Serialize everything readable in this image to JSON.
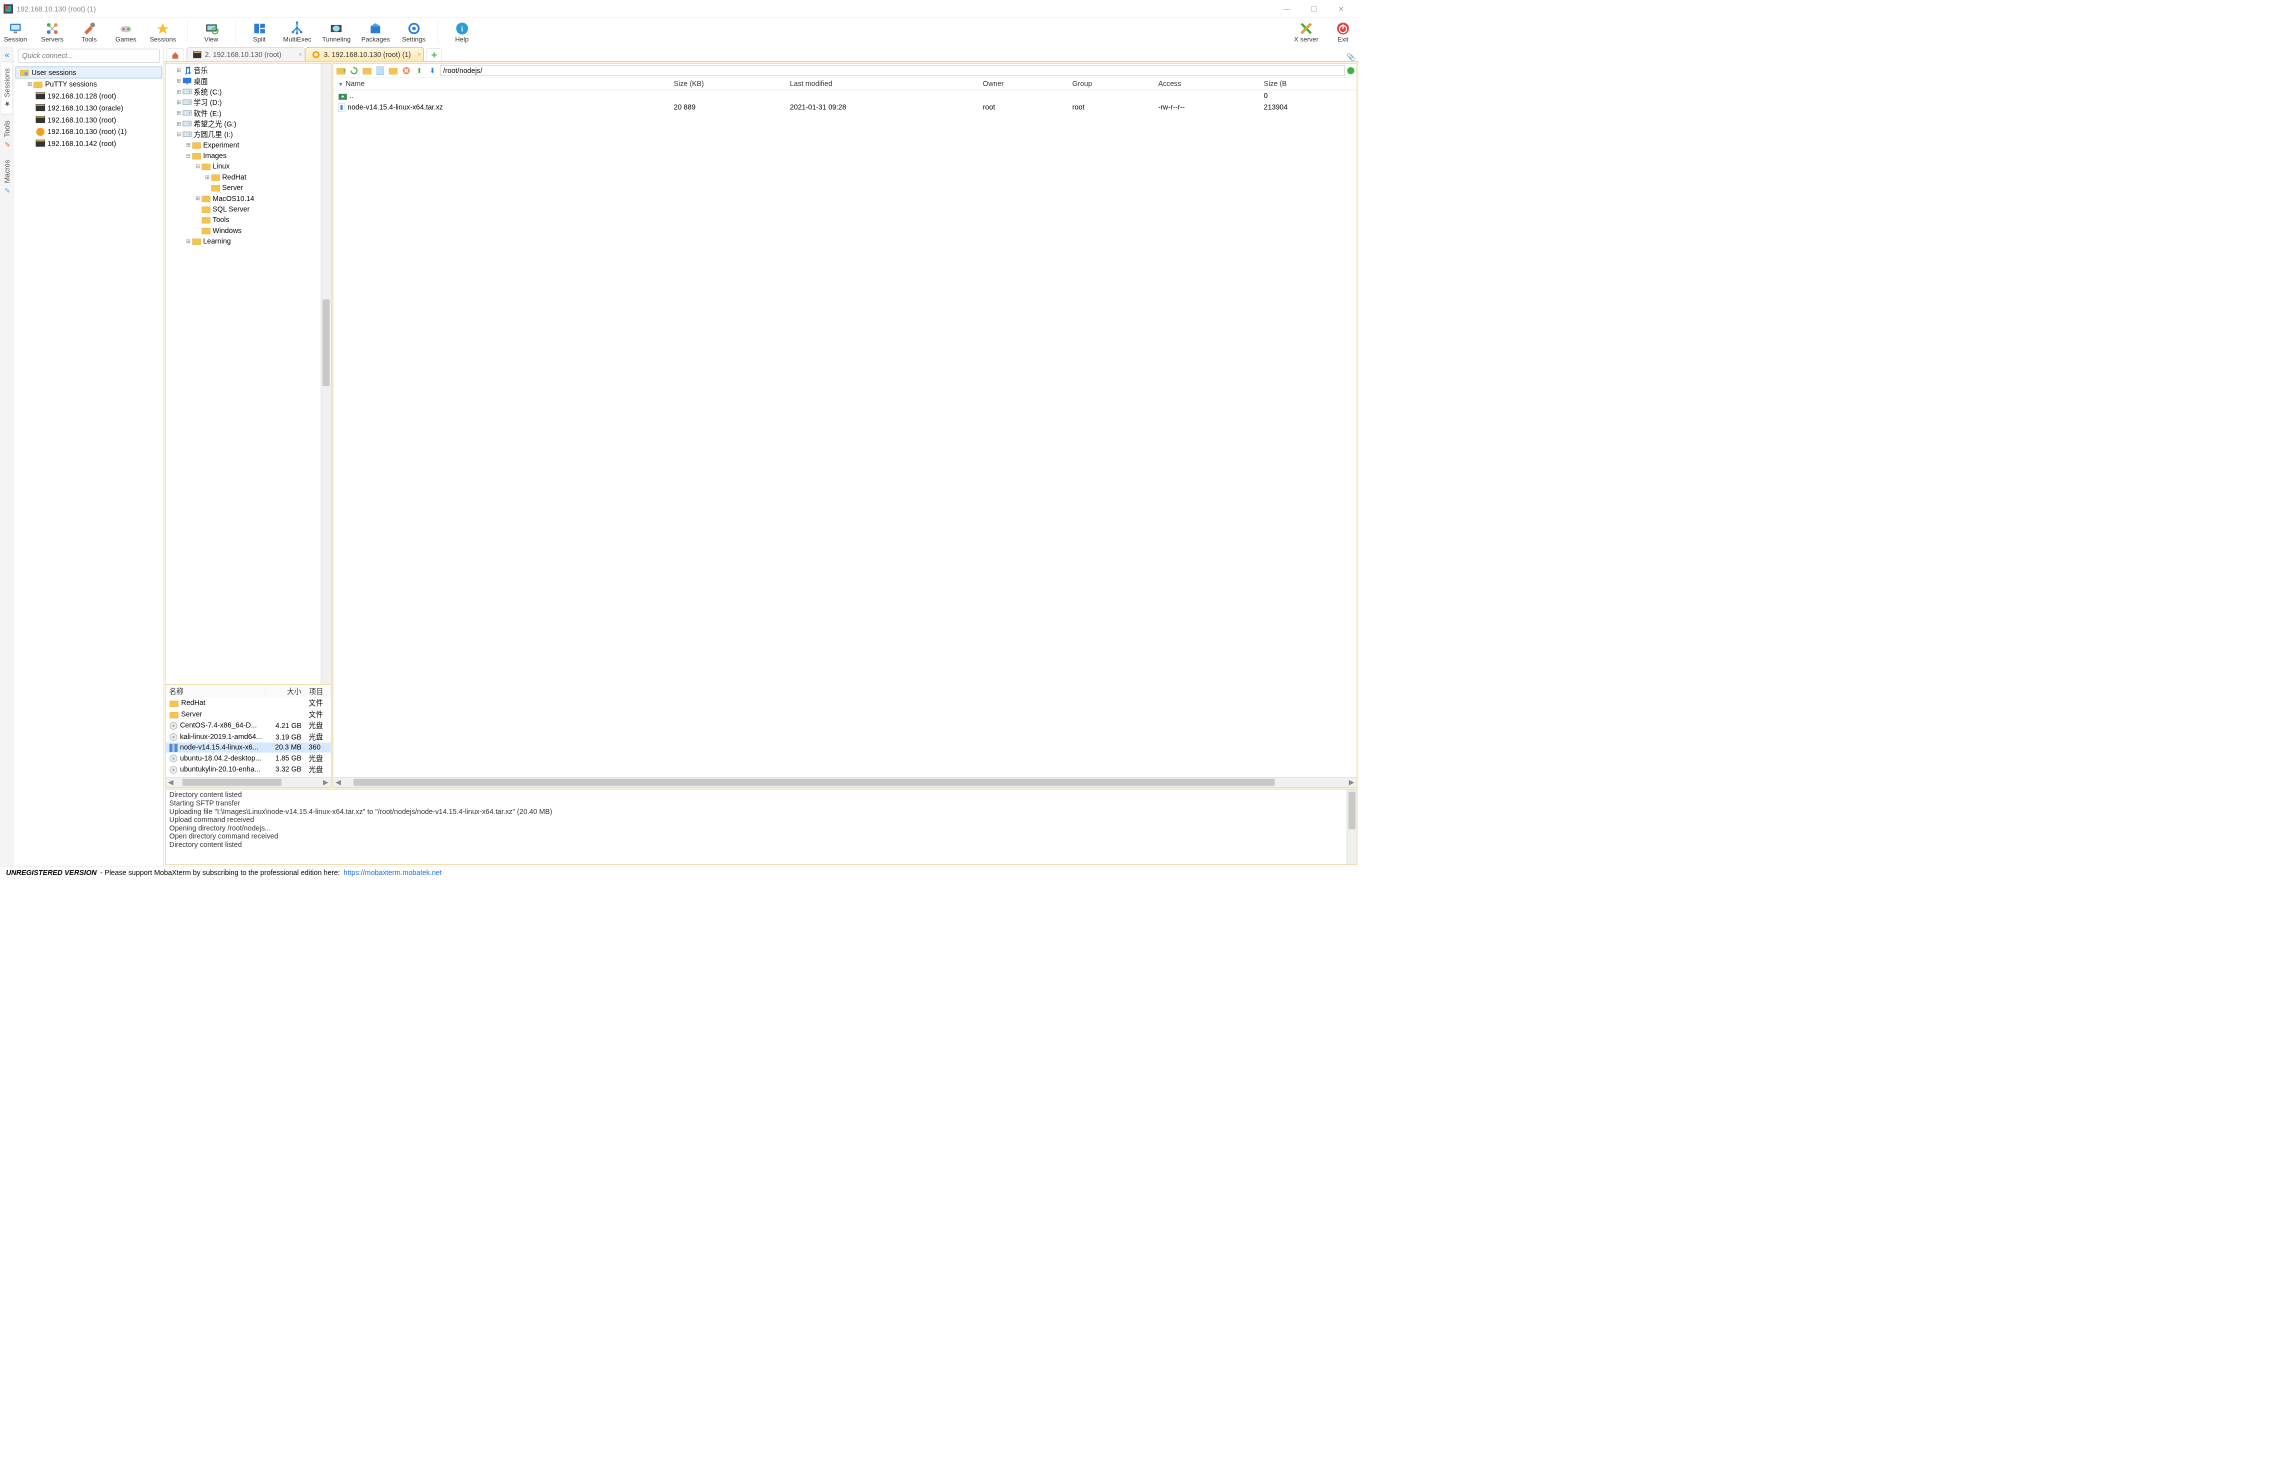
{
  "window": {
    "title": "192.168.10.130 (root) (1)",
    "minimize": "—",
    "maximize": "☐",
    "close": "✕"
  },
  "toolbar": [
    {
      "id": "session",
      "label": "Session"
    },
    {
      "id": "servers",
      "label": "Servers"
    },
    {
      "id": "tools",
      "label": "Tools"
    },
    {
      "id": "games",
      "label": "Games"
    },
    {
      "id": "sessions",
      "label": "Sessions"
    },
    {
      "id": "view",
      "label": "View"
    },
    {
      "id": "split",
      "label": "Split"
    },
    {
      "id": "multiexec",
      "label": "MultiExec"
    },
    {
      "id": "tunneling",
      "label": "Tunneling"
    },
    {
      "id": "packages",
      "label": "Packages"
    },
    {
      "id": "settings",
      "label": "Settings"
    },
    {
      "id": "help",
      "label": "Help"
    }
  ],
  "toolbar_right": [
    {
      "id": "xserver",
      "label": "X server"
    },
    {
      "id": "exit",
      "label": "Exit"
    }
  ],
  "quick_connect_placeholder": "Quick connect...",
  "vtabs": [
    {
      "id": "sessions",
      "label": "Sessions",
      "active": true
    },
    {
      "id": "tools",
      "label": "Tools",
      "active": false
    },
    {
      "id": "macros",
      "label": "Macros",
      "active": false
    }
  ],
  "session_tree": {
    "root": "User sessions",
    "putty_folder": "PuTTY sessions",
    "items": [
      {
        "label": "192.168.10.128 (root)",
        "active": false
      },
      {
        "label": "192.168.10.130 (oracle)",
        "active": false
      },
      {
        "label": "192.168.10.130 (root)",
        "active": false
      },
      {
        "label": "192.168.10.130 (root) (1)",
        "active": true
      },
      {
        "label": "192.168.10.142 (root)",
        "active": false
      }
    ]
  },
  "tabs": [
    {
      "id": "t2",
      "label": "2. 192.168.10.130 (root)",
      "active": false
    },
    {
      "id": "t3",
      "label": "3. 192.168.10.130 (root) (1)",
      "active": true
    }
  ],
  "local_tree": [
    {
      "indent": 0,
      "exp": "⊞",
      "icon": "music",
      "label": "音乐"
    },
    {
      "indent": 0,
      "exp": "⊞",
      "icon": "desktop",
      "label": "桌面"
    },
    {
      "indent": 0,
      "exp": "⊞",
      "icon": "drive",
      "label": "系统 (C:)"
    },
    {
      "indent": 0,
      "exp": "⊞",
      "icon": "drive",
      "label": "学习 (D:)"
    },
    {
      "indent": 0,
      "exp": "⊞",
      "icon": "drive",
      "label": "软件 (E:)"
    },
    {
      "indent": 0,
      "exp": "⊞",
      "icon": "drive",
      "label": "希望之光 (G:)"
    },
    {
      "indent": 0,
      "exp": "⊟",
      "icon": "drive",
      "label": "方圆几里 (I:)"
    },
    {
      "indent": 1,
      "exp": "⊞",
      "icon": "folder",
      "label": "Experiment"
    },
    {
      "indent": 1,
      "exp": "⊟",
      "icon": "folder",
      "label": "Images"
    },
    {
      "indent": 2,
      "exp": "⊟",
      "icon": "folder",
      "label": "Linux"
    },
    {
      "indent": 3,
      "exp": "⊞",
      "icon": "folder",
      "label": "RedHat"
    },
    {
      "indent": 3,
      "exp": "",
      "icon": "folder",
      "label": "Server"
    },
    {
      "indent": 2,
      "exp": "⊞",
      "icon": "folder",
      "label": "MacOS10.14"
    },
    {
      "indent": 2,
      "exp": "",
      "icon": "folder",
      "label": "SQL Server"
    },
    {
      "indent": 2,
      "exp": "",
      "icon": "folder",
      "label": "Tools"
    },
    {
      "indent": 2,
      "exp": "",
      "icon": "folder",
      "label": "Windows"
    },
    {
      "indent": 1,
      "exp": "⊞",
      "icon": "folder",
      "label": "Learning"
    }
  ],
  "local_list": {
    "headers": [
      "名称",
      "大小",
      "项目"
    ],
    "rows": [
      {
        "icon": "folder",
        "name": "RedHat",
        "size": "",
        "type": "文件",
        "selected": false
      },
      {
        "icon": "folder",
        "name": "Server",
        "size": "",
        "type": "文件",
        "selected": false
      },
      {
        "icon": "iso",
        "name": "CentOS-7.4-x86_64-D...",
        "size": "4.21 GB",
        "type": "光盘",
        "selected": false
      },
      {
        "icon": "iso",
        "name": "kali-linux-2019.1-amd64...",
        "size": "3.19 GB",
        "type": "光盘",
        "selected": false
      },
      {
        "icon": "archive",
        "name": "node-v14.15.4-linux-x6...",
        "size": "20.3 MB",
        "type": "360",
        "selected": true
      },
      {
        "icon": "iso",
        "name": "ubuntu-18.04.2-desktop...",
        "size": "1.85 GB",
        "type": "光盘",
        "selected": false
      },
      {
        "icon": "iso",
        "name": "ubuntukylin-20.10-enha...",
        "size": "3.32 GB",
        "type": "光盘",
        "selected": false
      }
    ]
  },
  "sftp": {
    "path": "/root/nodejs/",
    "headers": [
      "Name",
      "Size (KB)",
      "Last modified",
      "Owner",
      "Group",
      "Access",
      "Size (B"
    ],
    "parent_row": "..",
    "rows": [
      {
        "name": "node-v14.15.4-linux-x64.tar.xz",
        "size": "20 889",
        "modified": "2021-01-31 09:28",
        "owner": "root",
        "group": "root",
        "access": "-rw-r--r--",
        "sizeb": "213904"
      }
    ],
    "parent_sizeb": "0"
  },
  "log_lines": [
    "Directory content listed",
    "Starting SFTP transfer",
    "Uploading file \"I:\\Images\\Linux\\node-v14.15.4-linux-x64.tar.xz\" to \"/root/nodejs/node-v14.15.4-linux-x64.tar.xz\" (20.40 MB)",
    "Upload command received",
    "Opening directory /root/nodejs...",
    "Open directory command received",
    "Directory content listed"
  ],
  "statusbar": {
    "unregistered": "UNREGISTERED VERSION",
    "msg": "-   Please support MobaXterm by subscribing to the professional edition here:",
    "url": "https://mobaxterm.mobatek.net"
  }
}
